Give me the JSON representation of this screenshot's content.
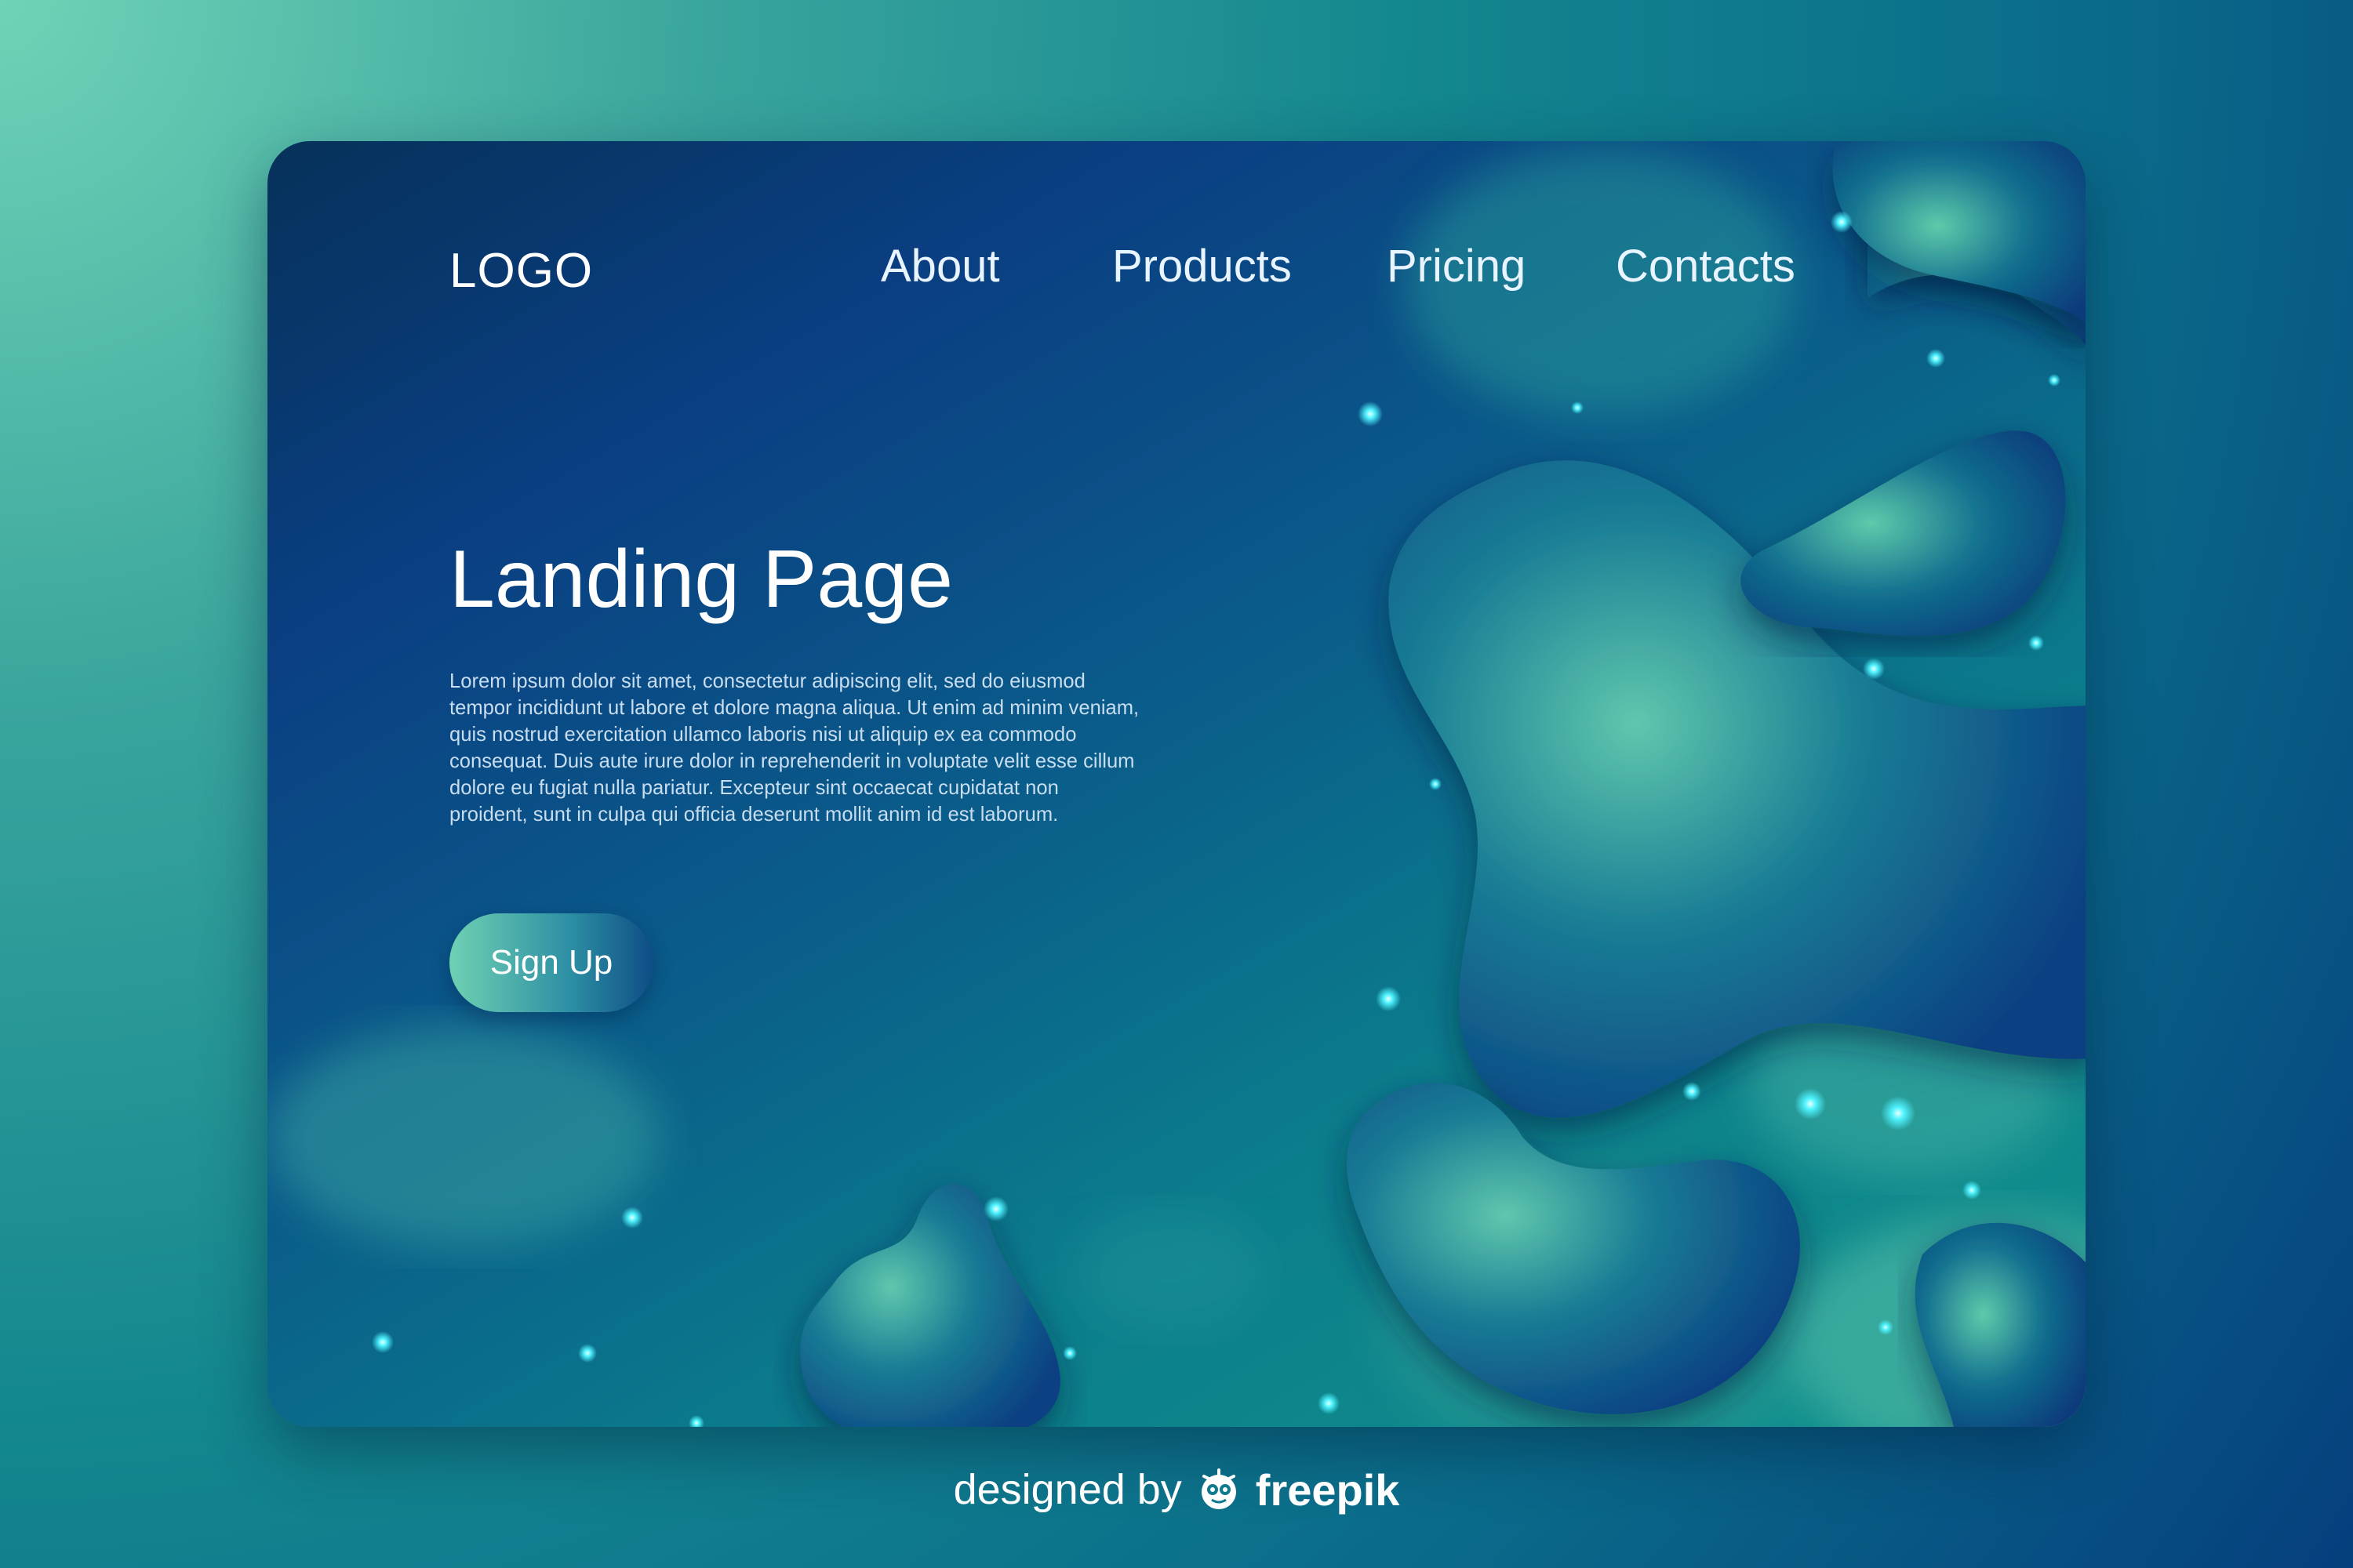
{
  "header": {
    "logo": "LOGO",
    "nav": [
      {
        "label": "About"
      },
      {
        "label": "Products"
      },
      {
        "label": "Pricing"
      },
      {
        "label": "Contacts"
      }
    ]
  },
  "hero": {
    "title": "Landing Page",
    "body": "Lorem ipsum dolor sit amet, consectetur adipiscing elit, sed do eiusmod tempor incididunt ut labore et dolore magna aliqua. Ut enim ad minim veniam, quis nostrud exercitation ullamco laboris nisi ut aliquip ex ea commodo consequat. Duis aute irure dolor in reprehenderit in voluptate velit esse cillum dolore eu fugiat nulla pariatur. Excepteur sint occaecat cupidatat non proident, sunt in culpa qui officia deserunt mollit anim id est laborum.",
    "cta": "Sign Up"
  },
  "credit": {
    "prefix": "designed by",
    "brand": "freepik",
    "icon": "freepik-logo-icon"
  },
  "colors": {
    "accent": "#6fd1b3",
    "card_dark": "#0a3f82",
    "glow": "#4ff3ff"
  }
}
